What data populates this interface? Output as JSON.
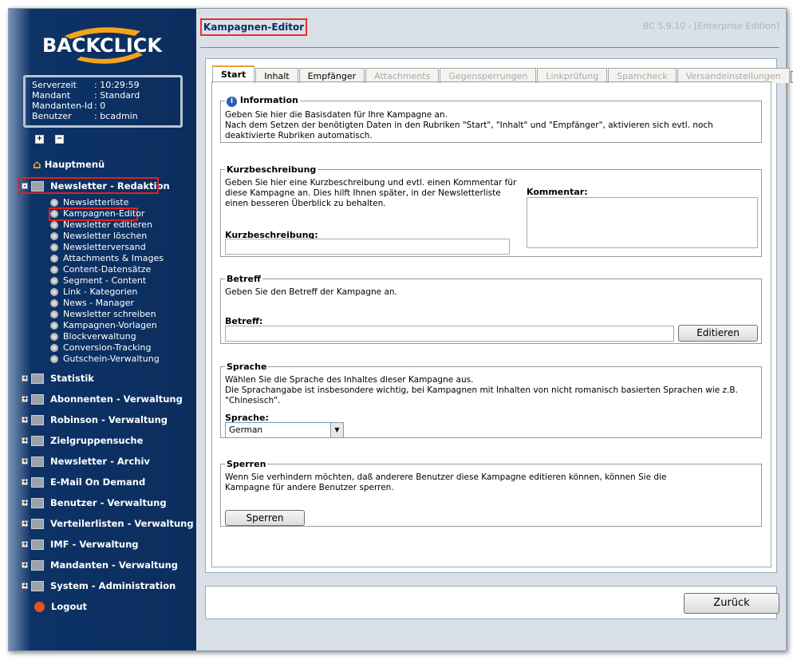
{
  "logo": "BACKCLICK",
  "info": [
    [
      "Serverzeit",
      ": 10:29:59"
    ],
    [
      "Mandant",
      ": Standard"
    ],
    [
      "Mandanten-Id",
      ": 0"
    ],
    [
      "Benutzer",
      ": bcadmin"
    ]
  ],
  "nav": {
    "home": "Hauptmenü",
    "redaktion": "Newsletter - Redaktion",
    "sub": [
      "Newsletterliste",
      "Kampagnen-Editor",
      "Newsletter editieren",
      "Newsletter löschen",
      "Newsletterversand",
      "Attachments & Images",
      "Content-Datensätze",
      "Segment - Content",
      "Link - Kategorien",
      "News - Manager",
      "Newsletter schreiben",
      "Kampagnen-Vorlagen",
      "Blockverwaltung",
      "Conversion-Tracking",
      "Gutschein-Verwaltung"
    ],
    "sections": [
      "Statistik",
      "Abonnenten - Verwaltung",
      "Robinson - Verwaltung",
      "Zielgruppensuche",
      "Newsletter - Archiv",
      "E-Mail On Demand",
      "Benutzer - Verwaltung",
      "Verteilerlisten - Verwaltung",
      "IMF - Verwaltung",
      "Mandanten - Verwaltung",
      "System - Administration"
    ],
    "logout": "Logout"
  },
  "header": {
    "title": "Kampagnen-Editor",
    "version": "BC 5.9.10 - [Enterprise Edition]"
  },
  "tabs": [
    {
      "label": "Start",
      "state": "active"
    },
    {
      "label": "Inhalt",
      "state": "enabled"
    },
    {
      "label": "Empfänger",
      "state": "enabled"
    },
    {
      "label": "Attachments",
      "state": "disabled"
    },
    {
      "label": "Gegensperrungen",
      "state": "disabled"
    },
    {
      "label": "Linkprüfung",
      "state": "disabled"
    },
    {
      "label": "Spamcheck",
      "state": "disabled"
    },
    {
      "label": "Versandeinstellungen",
      "state": "disabled"
    }
  ],
  "information": {
    "legend": "Information",
    "line1": "Geben Sie hier die Basisdaten für Ihre Kampagne an.",
    "line2": "Nach dem Setzen der benötigten Daten in den Rubriken \"Start\", \"Inhalt\" und \"Empfänger\", aktivieren sich evtl. noch deaktivierte Rubriken automatisch."
  },
  "kurz": {
    "legend": "Kurzbeschreibung",
    "text": "Geben Sie hier eine Kurzbeschreibung und evtl. einen Kommentar für diese Kampagne an. Dies hilft Ihnen später, in der Newsletterliste einen besseren Überblick zu behalten.",
    "label": "Kurzbeschreibung:",
    "value": "",
    "komm_label": "Kommentar:",
    "komm_value": ""
  },
  "betreff": {
    "legend": "Betreff",
    "text": "Geben Sie den Betreff der Kampagne an.",
    "label": "Betreff:",
    "value": "",
    "button": "Editieren"
  },
  "sprache": {
    "legend": "Sprache",
    "line1": "Wählen Sie die Sprache des Inhaltes dieser Kampagne aus.",
    "line2": "Die Sprachangabe ist insbesondere wichtig, bei Kampagnen mit Inhalten von nicht romanisch basierten Sprachen wie z.B. \"Chinesisch\".",
    "label": "Sprache:",
    "value": "German"
  },
  "sperren": {
    "legend": "Sperren",
    "text": "Wenn Sie verhindern möchten, daß anderere Benutzer diese Kampagne editieren können, können Sie die Kampagne für andere Benutzer sperren.",
    "button": "Sperren"
  },
  "footer": {
    "back": "Zurück"
  }
}
